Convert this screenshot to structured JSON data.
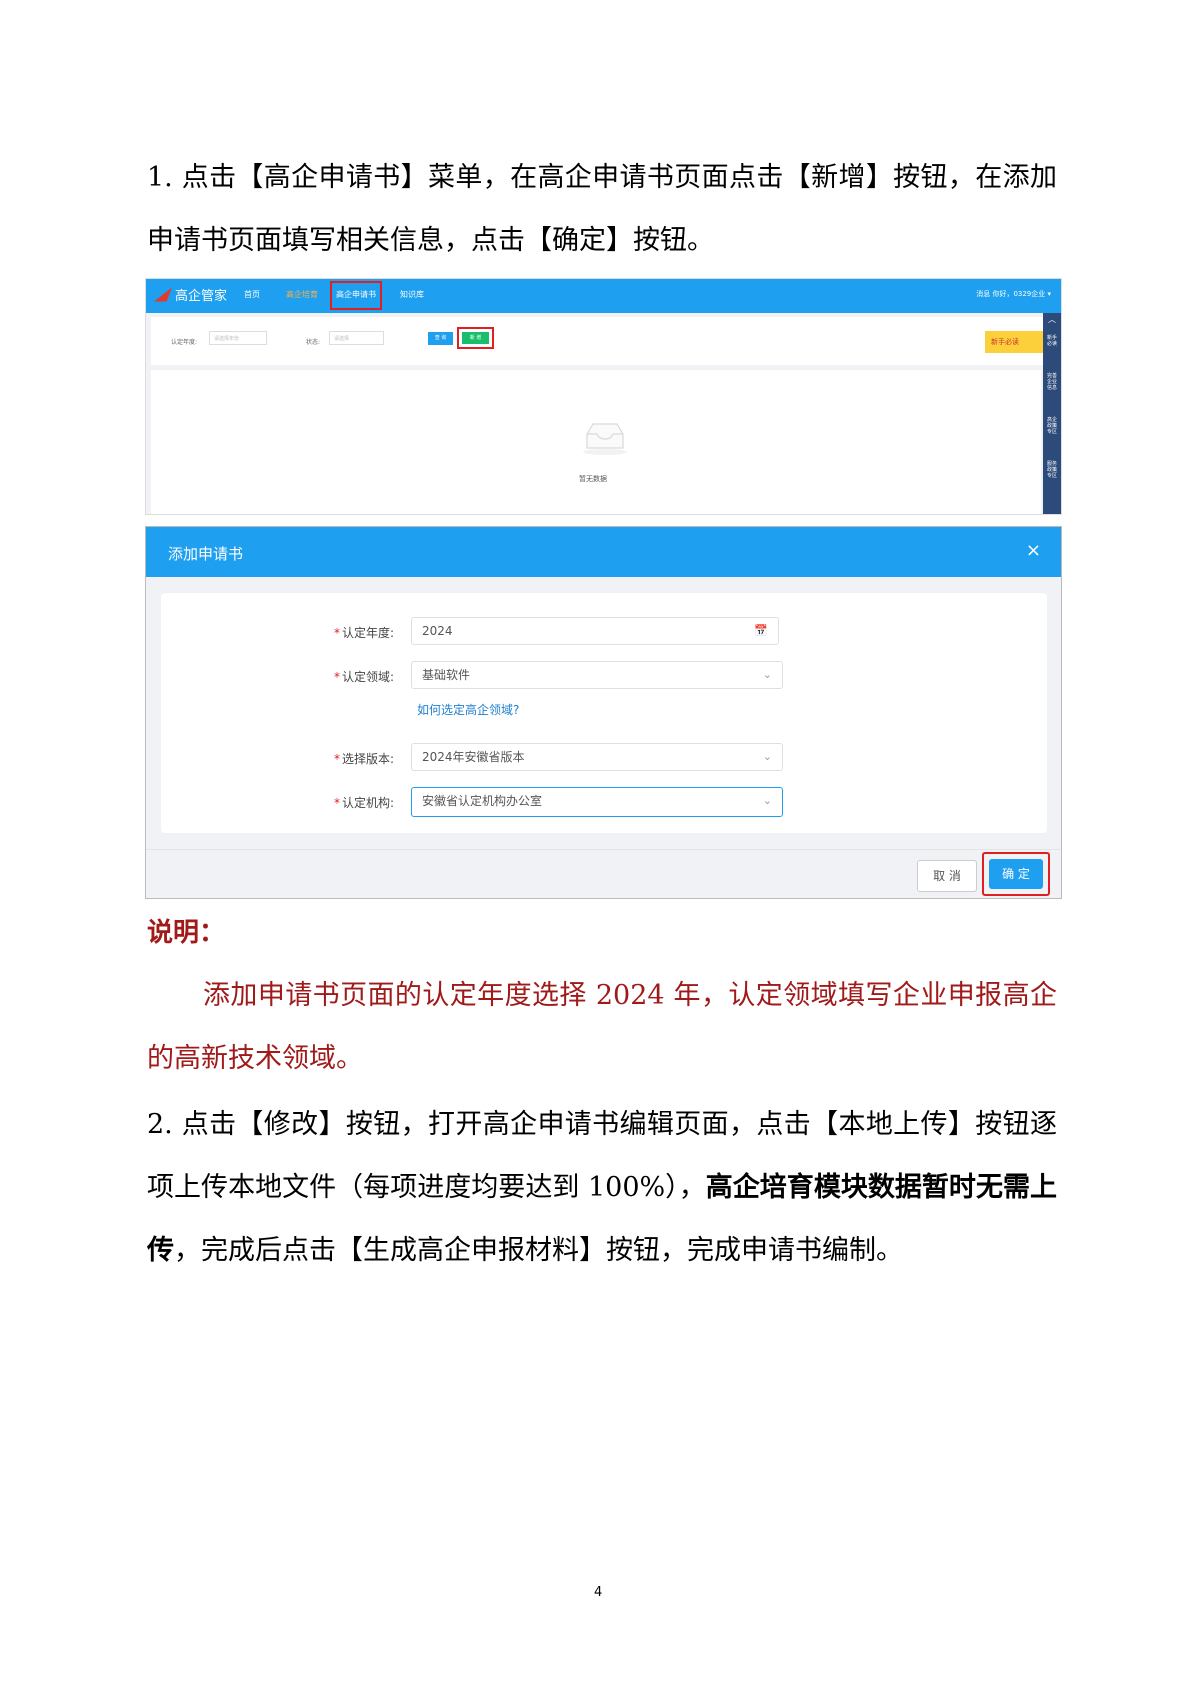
{
  "step1": {
    "text": "1. 点击【高企申请书】菜单，在高企申请书页面点击【新增】按钮，在添加申请书页面填写相关信息，点击【确定】按钮。"
  },
  "screen1": {
    "logo": "高企管家",
    "nav": [
      "首页",
      "高企培育",
      "高企申请书",
      "知识库"
    ],
    "user_area": "消息  你好，0329企业 ▾",
    "filter": {
      "year_label": "认定年度:",
      "year_placeholder": "请选择年份",
      "status_label": "状态:",
      "status_placeholder": "请选择",
      "search_btn": "查 询",
      "add_btn": "新 增"
    },
    "guide_btn": "新手必读",
    "right_rail": [
      "新手必读",
      "完善企业信息",
      "高企政策专区",
      "服务政策专区"
    ],
    "empty_text": "暂无数据"
  },
  "dialog": {
    "title": "添加申请书",
    "close": "×",
    "fields": [
      {
        "label": "认定年度:",
        "value": "2024"
      },
      {
        "label": "认定领域:",
        "value": "基础软件"
      },
      {
        "label": "选择版本:",
        "value": "2024年安徽省版本"
      },
      {
        "label": "认定机构:",
        "value": "安徽省认定机构办公室"
      }
    ],
    "help_link": "如何选定高企领域?",
    "cancel": "取 消",
    "ok": "确 定"
  },
  "note": {
    "heading": "说明：",
    "text": "添加申请书页面的认定年度选择 2024 年，认定领域填写企业申报高企的高新技术领域。"
  },
  "step2": {
    "part1": "2. 点击【修改】按钮，打开高企申请书编辑页面，点击【本地上传】按钮逐项上传本地文件（每项进度均要达到 100%），",
    "bold": "高企培育模块数据暂时无需上传",
    "part2": "，完成后点击【生成高企申报材料】按钮，完成申请书编制。"
  },
  "page_number": "4"
}
